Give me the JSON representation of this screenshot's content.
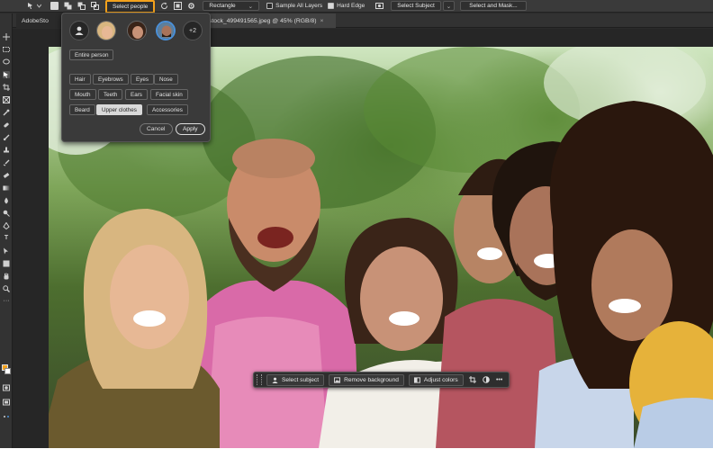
{
  "options_bar": {
    "select_people_label": "Select people",
    "mode_label": "Rectangle",
    "sample_all_layers_label": "Sample All Layers",
    "hard_edge_label": "Hard Edge",
    "select_subject_label": "Select Subject",
    "select_and_mask_label": "Select and Mask..."
  },
  "tabs": [
    {
      "label": "AdobeSto"
    },
    {
      "label": "stock_499491565.jpeg @ 45% (RGB/8)"
    }
  ],
  "select_people_panel": {
    "more_count": "+2",
    "entire_person_label": "Entire person",
    "chips_row1": [
      "Hair",
      "Eyebrows",
      "Eyes",
      "Nose"
    ],
    "chips_row2": [
      "Mouth",
      "Teeth",
      "Ears",
      "Facial skin"
    ],
    "chips_row3": [
      "Beard",
      "Upper clothes",
      "Accessories"
    ],
    "selected_chip": "Upper clothes",
    "cancel_label": "Cancel",
    "apply_label": "Apply"
  },
  "taskbar": {
    "select_subject_label": "Select subject",
    "remove_background_label": "Remove background",
    "adjust_colors_label": "Adjust colors",
    "more_label": "•••"
  },
  "colors": {
    "accent_highlight": "#f4a21c",
    "foreground_color": "#f4a21c",
    "background_color": "#ffffff"
  }
}
